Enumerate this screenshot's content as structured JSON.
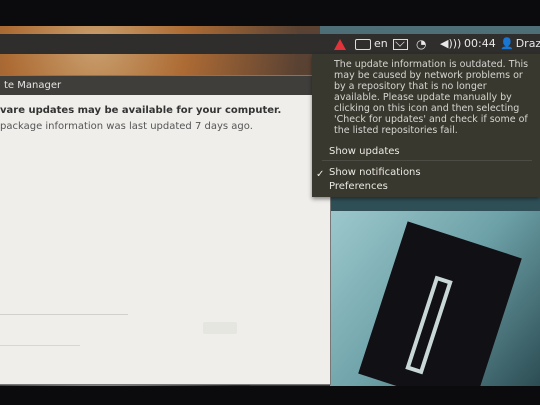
{
  "panel": {
    "keyboard_layout": "en",
    "clock": "00:44",
    "user": "Draze"
  },
  "window": {
    "title": "te Manager",
    "heading": "vare updates may be available for your computer.",
    "subtext": "package information was last updated 7 days ago."
  },
  "menu": {
    "message": "The update information is outdated. This may be caused by network problems or by a repository that is no longer available. Please update manually by clicking on this icon and then selecting 'Check for updates' and check if some of the listed repositories fail.",
    "show_updates": "Show updates",
    "show_notifications": "Show notifications",
    "preferences": "Preferences",
    "check_mark": "✓"
  },
  "icons": {
    "update_alert": "warning-triangle-icon",
    "keyboard": "keyboard-icon",
    "mail": "mail-icon",
    "wifi": "wifi-icon",
    "volume": "volume-icon",
    "user": "user-icon"
  },
  "colors": {
    "panel_bg": "#2f2e2c",
    "menu_bg": "#39382f",
    "alert_red": "#e0343a",
    "window_bg": "#efeeeb"
  }
}
